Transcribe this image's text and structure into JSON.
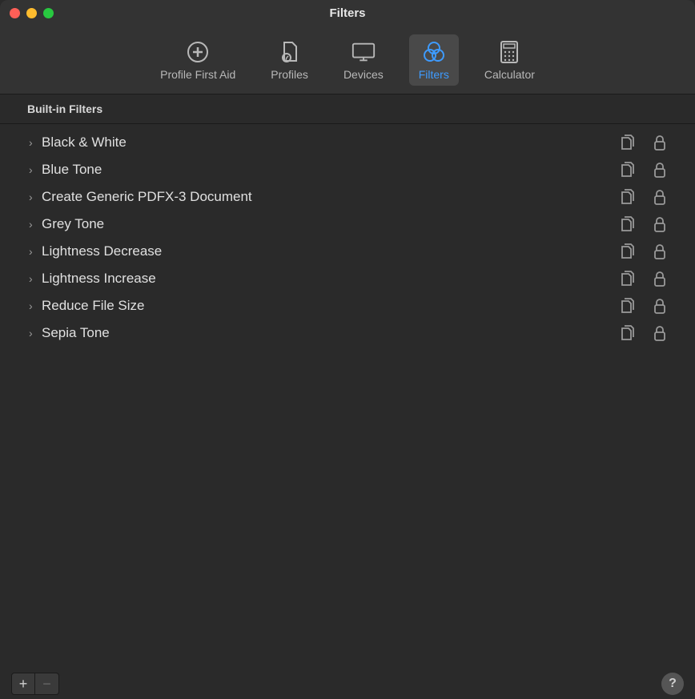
{
  "window": {
    "title": "Filters"
  },
  "toolbar": {
    "items": [
      {
        "label": "Profile First Aid",
        "active": false,
        "icon": "plus-circle"
      },
      {
        "label": "Profiles",
        "active": false,
        "icon": "profile-doc"
      },
      {
        "label": "Devices",
        "active": false,
        "icon": "monitor"
      },
      {
        "label": "Filters",
        "active": true,
        "icon": "rings"
      },
      {
        "label": "Calculator",
        "active": false,
        "icon": "calculator"
      }
    ]
  },
  "section": {
    "header": "Built-in Filters"
  },
  "filters": [
    {
      "name": "Black & White"
    },
    {
      "name": "Blue Tone"
    },
    {
      "name": "Create Generic PDFX-3 Document"
    },
    {
      "name": "Grey Tone"
    },
    {
      "name": "Lightness Decrease"
    },
    {
      "name": "Lightness Increase"
    },
    {
      "name": "Reduce File Size"
    },
    {
      "name": "Sepia Tone"
    }
  ],
  "footer": {
    "add": "+",
    "remove": "−",
    "help": "?"
  }
}
